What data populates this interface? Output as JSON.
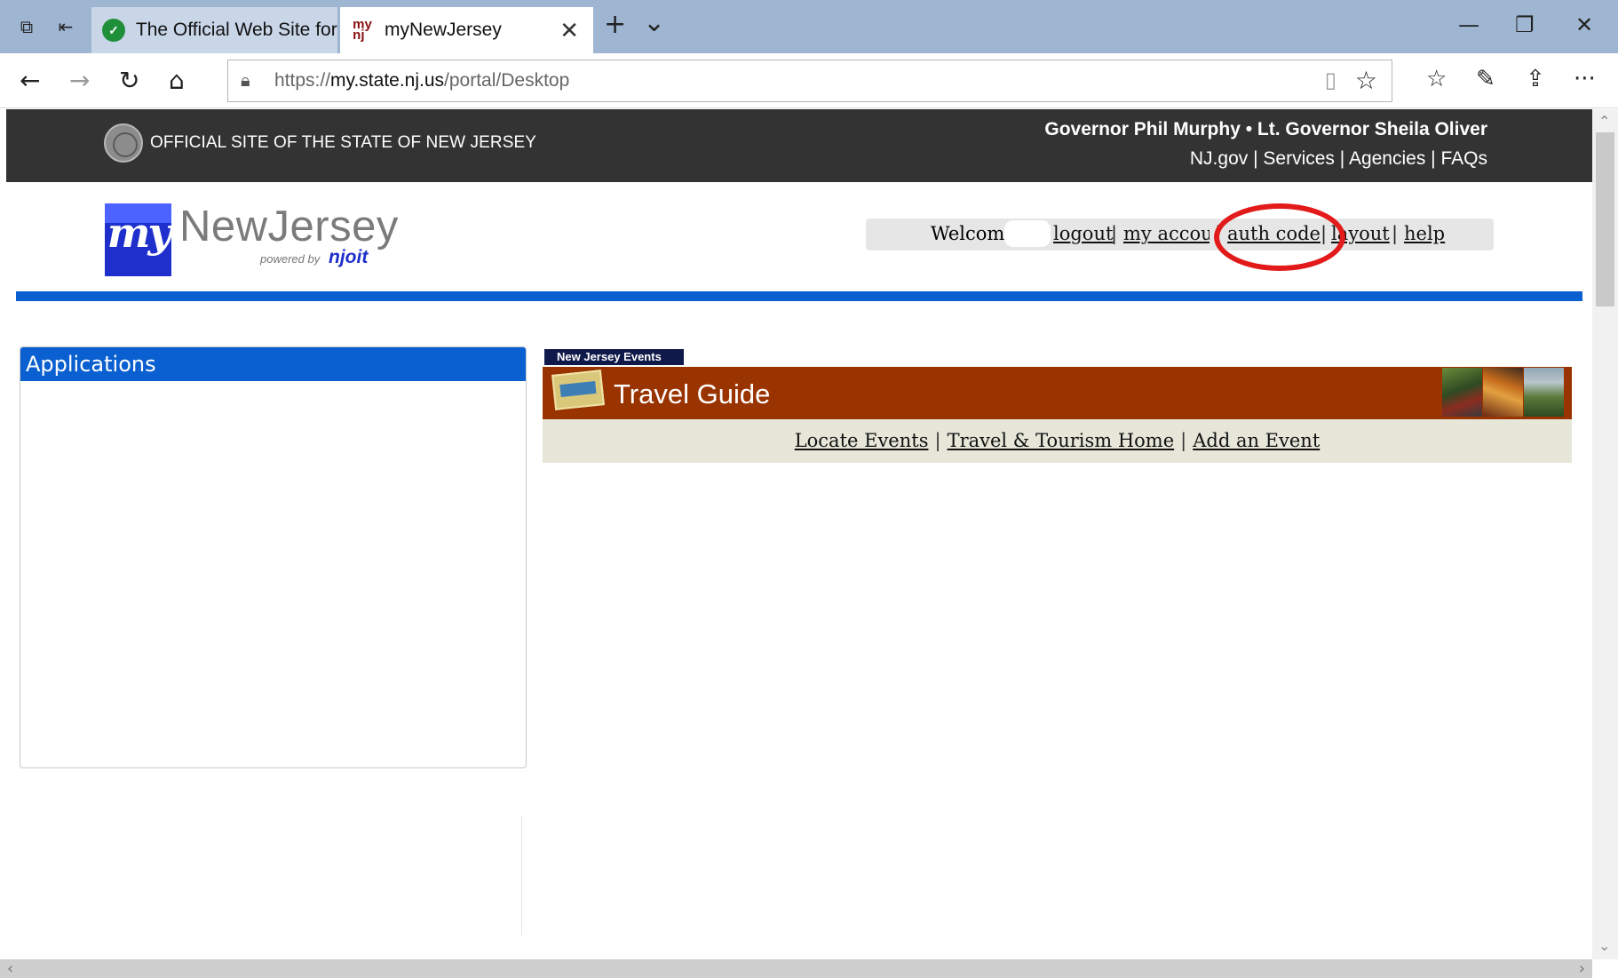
{
  "browser": {
    "tabs": [
      {
        "title": "The Official Web Site for The State of New Jersey",
        "favicon": "nj-state-icon"
      },
      {
        "title": "myNewJersey",
        "favicon": "mynj-icon",
        "active": true
      }
    ],
    "tab_close": "✕",
    "new_tab": "+",
    "tab_list": "⌄",
    "window_controls": {
      "minimize": "—",
      "restore": "❐",
      "close": "✕"
    },
    "address": {
      "prefix": "https://",
      "host": "my.state.nj.us",
      "path": "/portal/Desktop"
    },
    "nav_icons": {
      "back": "←",
      "forward": "→",
      "refresh": "↻",
      "home": "⌂"
    },
    "toolbar_icons": {
      "favorites_bar": "☆",
      "notes": "✎",
      "share": "⇪",
      "more": "···",
      "reading_view": "▯",
      "favorite_star": "☆"
    }
  },
  "gov_bar": {
    "official_site": "OFFICIAL SITE OF THE STATE OF NEW JERSEY",
    "governor_line": "Governor Phil Murphy • Lt. Governor Sheila Oliver",
    "links": [
      "NJ.gov",
      "Services",
      "Agencies",
      "FAQs"
    ],
    "separator": "|"
  },
  "logo": {
    "my": "my",
    "newjersey": "NewJersey",
    "powered": "powered by",
    "njoit": "njoit"
  },
  "user_bar": {
    "welcome": "Welcome",
    "links": {
      "logout": "logout",
      "my_account": "my account",
      "auth_code": "auth code",
      "layout": "layout",
      "help": "help"
    },
    "separator": "|"
  },
  "highlight_color": "#e21a1a",
  "apps_panel": {
    "title": "Applications"
  },
  "events": {
    "tab_label": "New Jersey Events",
    "title": "Travel Guide",
    "links": [
      "Locate Events",
      "Travel & Tourism Home",
      "Add an Event"
    ],
    "separator": "|"
  },
  "scrollbar_icons": {
    "up": "⌃",
    "down": "⌄",
    "left": "‹",
    "right": "›"
  }
}
